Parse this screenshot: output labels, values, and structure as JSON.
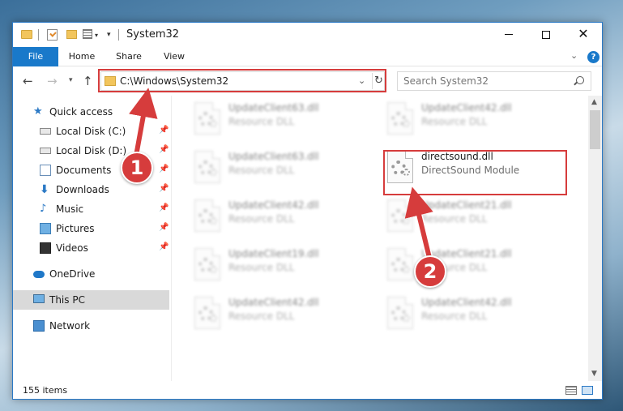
{
  "window": {
    "title": "System32"
  },
  "ribbon": {
    "tabs": [
      "File",
      "Home",
      "Share",
      "View"
    ],
    "help": "?"
  },
  "nav": {
    "address": "C:\\Windows\\System32",
    "search_placeholder": "Search System32"
  },
  "sidebar": {
    "items": [
      {
        "label": "Quick access"
      },
      {
        "label": "Local Disk (C:)"
      },
      {
        "label": "Local Disk (D:)"
      },
      {
        "label": "Documents"
      },
      {
        "label": "Downloads"
      },
      {
        "label": "Music"
      },
      {
        "label": "Pictures"
      },
      {
        "label": "Videos"
      },
      {
        "label": "OneDrive"
      },
      {
        "label": "This PC"
      },
      {
        "label": "Network"
      }
    ]
  },
  "files": [
    {
      "name": "UpdateClient63.dll",
      "type": "Resource DLL"
    },
    {
      "name": "UpdateClient42.dll",
      "type": "Resource DLL"
    },
    {
      "name": "UpdateClient63.dll",
      "type": "Resource DLL"
    },
    {
      "name": "directsound.dll",
      "type": "DirectSound Module"
    },
    {
      "name": "UpdateClient42.dll",
      "type": "Resource DLL"
    },
    {
      "name": "UpdateClient21.dll",
      "type": "Resource DLL"
    },
    {
      "name": "UpdateClient19.dll",
      "type": "Resource DLL"
    },
    {
      "name": "UpdateClient21.dll",
      "type": "Resource DLL"
    },
    {
      "name": "UpdateClient42.dll",
      "type": "Resource DLL"
    },
    {
      "name": "UpdateClient42.dll",
      "type": "Resource DLL"
    }
  ],
  "status": {
    "item_count": "155 items"
  },
  "annotations": {
    "step1": "1",
    "step2": "2"
  },
  "colors": {
    "accent": "#1979ca",
    "highlight": "#d63c3c"
  }
}
